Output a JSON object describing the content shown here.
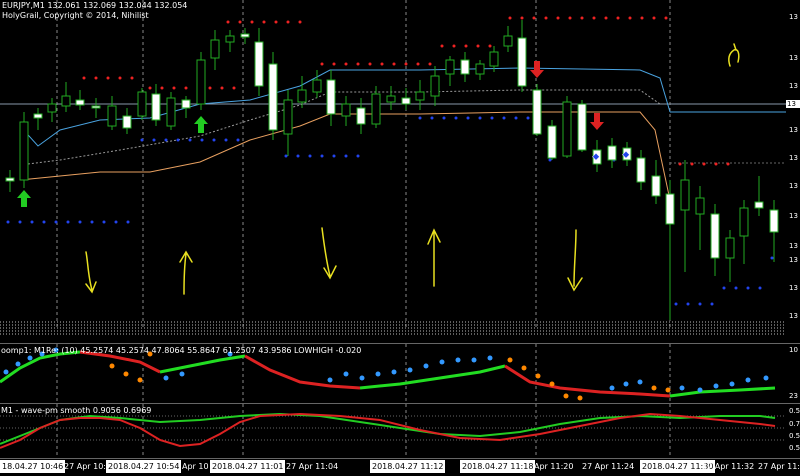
{
  "header": {
    "symbol_line": "EURJPY,M1  132.061 132.069 132.044 132.054",
    "indicator_line": "HolyGrail, Copyright © 2014, Nihilist"
  },
  "price_axis": {
    "labels": [
      "13",
      "13",
      "13",
      "13",
      "13",
      "13",
      "13",
      "13",
      "13",
      "13",
      "13",
      "13"
    ],
    "current_tag": "13"
  },
  "sub_window_1": {
    "title": "oomp1: M1Re: (10) 45.2574 45.2574 47.8064 55.8647 61.2507 43.9586  LOWHIGH -0.020",
    "right_top": "10",
    "right_bottom": "23"
  },
  "sub_window_2": {
    "title": "M1 - wave-pm smooth  0.9056 0.6969",
    "right_labels": [
      "0.5",
      "0.7",
      "0.5",
      "0.5"
    ]
  },
  "time_axis": {
    "labels": [
      {
        "text": "18.04.27 10:46",
        "highlight": true
      },
      {
        "text": "27 Apr 10:48",
        "highlight": false
      },
      {
        "text": "2018.04.27 10:54",
        "highlight": true
      },
      {
        "text": "Apr 10",
        "highlight": false
      },
      {
        "text": "2018.04.27 11:01",
        "highlight": true
      },
      {
        "text": "27 Apr 11:04",
        "highlight": false
      },
      {
        "text": "2018.04.27 11:12",
        "highlight": true
      },
      {
        "text": "2018.04.27 11:18",
        "highlight": true
      },
      {
        "text": "Apr 11:20",
        "highlight": false
      },
      {
        "text": "27 Apr 11:24",
        "highlight": false
      },
      {
        "text": "2018.04.27 11:30",
        "highlight": true
      },
      {
        "text": "27 Apr 11:32",
        "highlight": false
      },
      {
        "text": "27 Apr 11:",
        "highlight": false
      }
    ]
  },
  "colors": {
    "bull_candle": "#ffffff",
    "bear_candle": "#000000",
    "wick": "#22aa22",
    "upper_band": "#4aa3e0",
    "lower_band": "#e8a060",
    "up_arrow": "#22cc22",
    "down_arrow": "#dd2222",
    "hand_arrows": "#e8e020",
    "osc_green": "#22dd22",
    "osc_red": "#dd2222",
    "dot_blue": "#3399ff",
    "dot_orange": "#ff8800"
  }
}
